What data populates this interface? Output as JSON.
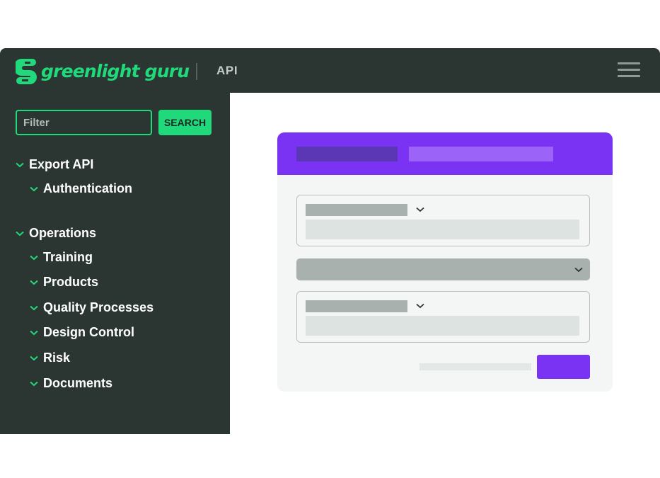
{
  "header": {
    "logo_text": "greenlight guru",
    "section_label": "API"
  },
  "sidebar": {
    "filter_placeholder": "Filter",
    "search_label": "SEARCH",
    "items": [
      {
        "label": "Export API",
        "level": 0
      },
      {
        "label": "Authentication",
        "level": 1
      },
      {
        "label": "Operations",
        "level": 0
      },
      {
        "label": "Training",
        "level": 1
      },
      {
        "label": "Products",
        "level": 1
      },
      {
        "label": "Quality Processes",
        "level": 1
      },
      {
        "label": "Design Control",
        "level": 1
      },
      {
        "label": "Risk",
        "level": 1
      },
      {
        "label": "Documents",
        "level": 1
      }
    ]
  },
  "icons": {
    "menu": "hamburger-menu-icon",
    "chevron": "chevron-down-icon",
    "logo": "greenlight-guru-logo-icon"
  },
  "colors": {
    "brand_green": "#20d97a",
    "dark_bg": "#2b3633",
    "accent_purple": "#7a33f2",
    "card_bg": "#f3f6f5"
  }
}
